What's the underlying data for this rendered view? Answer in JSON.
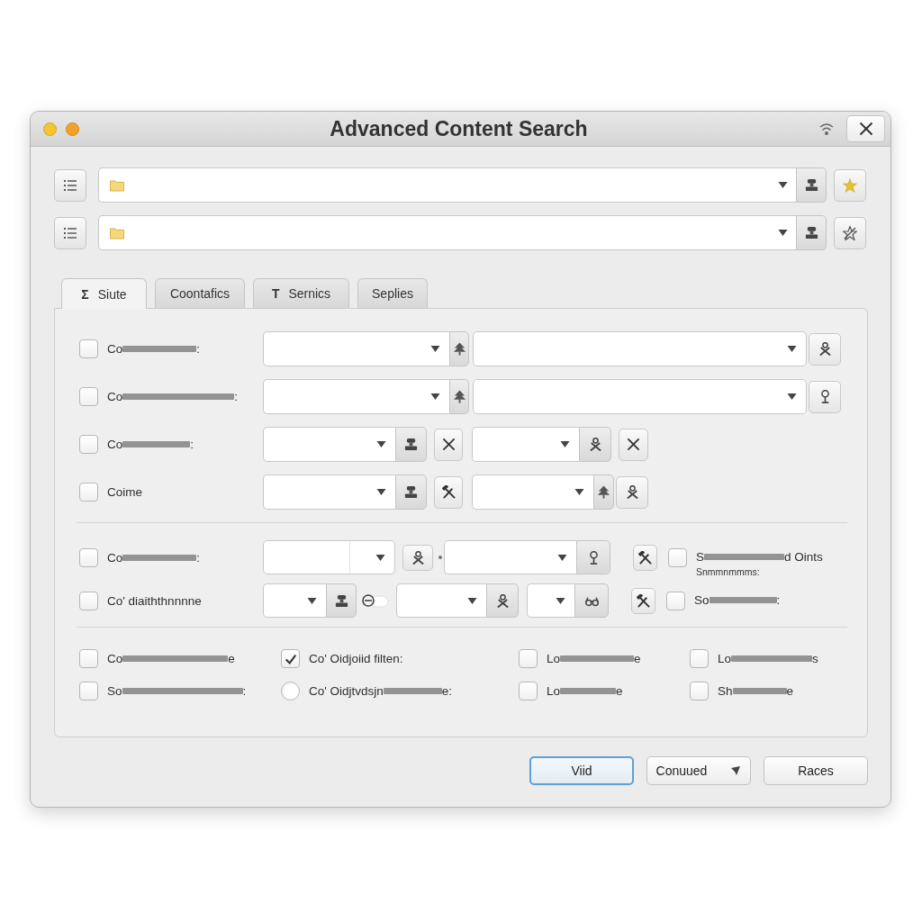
{
  "window": {
    "title": "Advanced Content Search"
  },
  "tabs": [
    {
      "icon": "Σ",
      "label": "Siute",
      "selected": true
    },
    {
      "label": "Coontafics",
      "selected": false
    },
    {
      "icon": "T",
      "label": "Sernics",
      "selected": false
    },
    {
      "label": "Seplies",
      "selected": false
    }
  ],
  "filters": [
    {
      "checked": false,
      "label": "Co",
      "label_end": ":"
    },
    {
      "checked": false,
      "label": "Co",
      "label_end": ":"
    },
    {
      "checked": false,
      "label": "Co",
      "label_end": ":"
    },
    {
      "checked": false,
      "label": "Coime"
    }
  ],
  "options": [
    {
      "checked": false,
      "label": "Co",
      "label_end": ":",
      "extra": {
        "checked": false,
        "label": "S",
        "label_end": "d Oints",
        "note": "Snmmnmmms:"
      }
    },
    {
      "checked": false,
      "label": "Co' diaiththnnnne",
      "toggle": {
        "on": false
      },
      "extra": {
        "checked": false,
        "label": "So",
        "label_end": ":"
      }
    }
  ],
  "flags": [
    {
      "kind": "checkbox",
      "checked": false,
      "label": "Co",
      "label_end": "e"
    },
    {
      "kind": "checkbox",
      "checked": true,
      "label": "Co' Oidjoiid filten:"
    },
    {
      "kind": "checkbox",
      "checked": false,
      "label": "Lo",
      "label_end": "e"
    },
    {
      "kind": "checkbox",
      "checked": false,
      "label": "Lo",
      "label_end": "s"
    },
    {
      "kind": "checkbox",
      "checked": false,
      "label": "So",
      "label_end": ":"
    },
    {
      "kind": "radio",
      "selected": false,
      "label": "Co' Oidjtvdsjn",
      "label_end": "e:"
    },
    {
      "kind": "checkbox",
      "checked": false,
      "label": "Lo",
      "label_end": "e"
    },
    {
      "kind": "checkbox",
      "checked": false,
      "label": "Sh",
      "label_end": "e"
    }
  ],
  "buttons": [
    {
      "label": "Viid",
      "default": true,
      "menu": false
    },
    {
      "label": "Conuued",
      "default": false,
      "menu": true
    },
    {
      "label": "Races",
      "default": false,
      "menu": false
    }
  ]
}
